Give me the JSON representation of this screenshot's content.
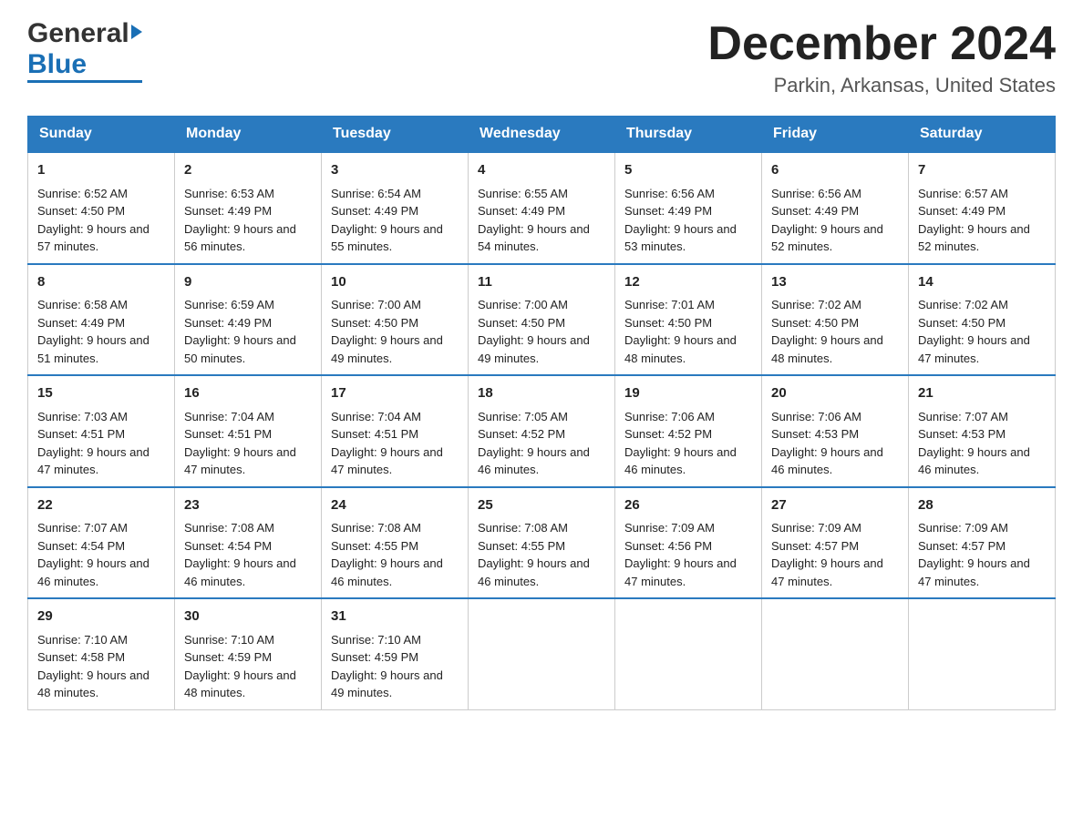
{
  "header": {
    "logo_general": "General",
    "logo_blue": "Blue",
    "title": "December 2024",
    "subtitle": "Parkin, Arkansas, United States"
  },
  "calendar": {
    "days_of_week": [
      "Sunday",
      "Monday",
      "Tuesday",
      "Wednesday",
      "Thursday",
      "Friday",
      "Saturday"
    ],
    "weeks": [
      [
        {
          "day": "1",
          "sunrise": "6:52 AM",
          "sunset": "4:50 PM",
          "daylight": "9 hours and 57 minutes."
        },
        {
          "day": "2",
          "sunrise": "6:53 AM",
          "sunset": "4:49 PM",
          "daylight": "9 hours and 56 minutes."
        },
        {
          "day": "3",
          "sunrise": "6:54 AM",
          "sunset": "4:49 PM",
          "daylight": "9 hours and 55 minutes."
        },
        {
          "day": "4",
          "sunrise": "6:55 AM",
          "sunset": "4:49 PM",
          "daylight": "9 hours and 54 minutes."
        },
        {
          "day": "5",
          "sunrise": "6:56 AM",
          "sunset": "4:49 PM",
          "daylight": "9 hours and 53 minutes."
        },
        {
          "day": "6",
          "sunrise": "6:56 AM",
          "sunset": "4:49 PM",
          "daylight": "9 hours and 52 minutes."
        },
        {
          "day": "7",
          "sunrise": "6:57 AM",
          "sunset": "4:49 PM",
          "daylight": "9 hours and 52 minutes."
        }
      ],
      [
        {
          "day": "8",
          "sunrise": "6:58 AM",
          "sunset": "4:49 PM",
          "daylight": "9 hours and 51 minutes."
        },
        {
          "day": "9",
          "sunrise": "6:59 AM",
          "sunset": "4:49 PM",
          "daylight": "9 hours and 50 minutes."
        },
        {
          "day": "10",
          "sunrise": "7:00 AM",
          "sunset": "4:50 PM",
          "daylight": "9 hours and 49 minutes."
        },
        {
          "day": "11",
          "sunrise": "7:00 AM",
          "sunset": "4:50 PM",
          "daylight": "9 hours and 49 minutes."
        },
        {
          "day": "12",
          "sunrise": "7:01 AM",
          "sunset": "4:50 PM",
          "daylight": "9 hours and 48 minutes."
        },
        {
          "day": "13",
          "sunrise": "7:02 AM",
          "sunset": "4:50 PM",
          "daylight": "9 hours and 48 minutes."
        },
        {
          "day": "14",
          "sunrise": "7:02 AM",
          "sunset": "4:50 PM",
          "daylight": "9 hours and 47 minutes."
        }
      ],
      [
        {
          "day": "15",
          "sunrise": "7:03 AM",
          "sunset": "4:51 PM",
          "daylight": "9 hours and 47 minutes."
        },
        {
          "day": "16",
          "sunrise": "7:04 AM",
          "sunset": "4:51 PM",
          "daylight": "9 hours and 47 minutes."
        },
        {
          "day": "17",
          "sunrise": "7:04 AM",
          "sunset": "4:51 PM",
          "daylight": "9 hours and 47 minutes."
        },
        {
          "day": "18",
          "sunrise": "7:05 AM",
          "sunset": "4:52 PM",
          "daylight": "9 hours and 46 minutes."
        },
        {
          "day": "19",
          "sunrise": "7:06 AM",
          "sunset": "4:52 PM",
          "daylight": "9 hours and 46 minutes."
        },
        {
          "day": "20",
          "sunrise": "7:06 AM",
          "sunset": "4:53 PM",
          "daylight": "9 hours and 46 minutes."
        },
        {
          "day": "21",
          "sunrise": "7:07 AM",
          "sunset": "4:53 PM",
          "daylight": "9 hours and 46 minutes."
        }
      ],
      [
        {
          "day": "22",
          "sunrise": "7:07 AM",
          "sunset": "4:54 PM",
          "daylight": "9 hours and 46 minutes."
        },
        {
          "day": "23",
          "sunrise": "7:08 AM",
          "sunset": "4:54 PM",
          "daylight": "9 hours and 46 minutes."
        },
        {
          "day": "24",
          "sunrise": "7:08 AM",
          "sunset": "4:55 PM",
          "daylight": "9 hours and 46 minutes."
        },
        {
          "day": "25",
          "sunrise": "7:08 AM",
          "sunset": "4:55 PM",
          "daylight": "9 hours and 46 minutes."
        },
        {
          "day": "26",
          "sunrise": "7:09 AM",
          "sunset": "4:56 PM",
          "daylight": "9 hours and 47 minutes."
        },
        {
          "day": "27",
          "sunrise": "7:09 AM",
          "sunset": "4:57 PM",
          "daylight": "9 hours and 47 minutes."
        },
        {
          "day": "28",
          "sunrise": "7:09 AM",
          "sunset": "4:57 PM",
          "daylight": "9 hours and 47 minutes."
        }
      ],
      [
        {
          "day": "29",
          "sunrise": "7:10 AM",
          "sunset": "4:58 PM",
          "daylight": "9 hours and 48 minutes."
        },
        {
          "day": "30",
          "sunrise": "7:10 AM",
          "sunset": "4:59 PM",
          "daylight": "9 hours and 48 minutes."
        },
        {
          "day": "31",
          "sunrise": "7:10 AM",
          "sunset": "4:59 PM",
          "daylight": "9 hours and 49 minutes."
        },
        null,
        null,
        null,
        null
      ]
    ]
  }
}
